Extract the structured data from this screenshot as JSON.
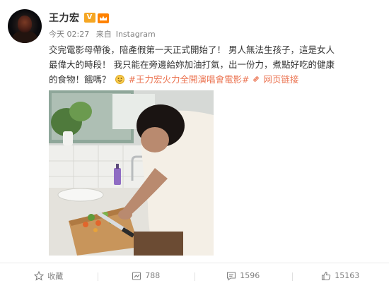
{
  "post": {
    "author": "王力宏",
    "vip_badge": "V",
    "time": "今天 02:27",
    "source_prefix": "来自",
    "source": "Instagram",
    "text_main": "交完電影母帶後，陪產假第一天正式開始了！ 男人無法生孩子，這是女人最偉大的時段！ 我只能在旁邊給妳加油打氣，出一份力，煮點好吃的健康的食物！餓嗎？",
    "topic_link": "#王力宏火力全開演唱會電影#",
    "web_link": "网页链接",
    "photo_description": "man cutting vegetables on a wooden board in a kitchen"
  },
  "actions": {
    "favorite_label": "收藏",
    "repost_count": "788",
    "comment_count": "1596",
    "like_count": "15163"
  },
  "colors": {
    "link": "#eb7350",
    "badge": "#f5a623",
    "meta": "#808080"
  }
}
